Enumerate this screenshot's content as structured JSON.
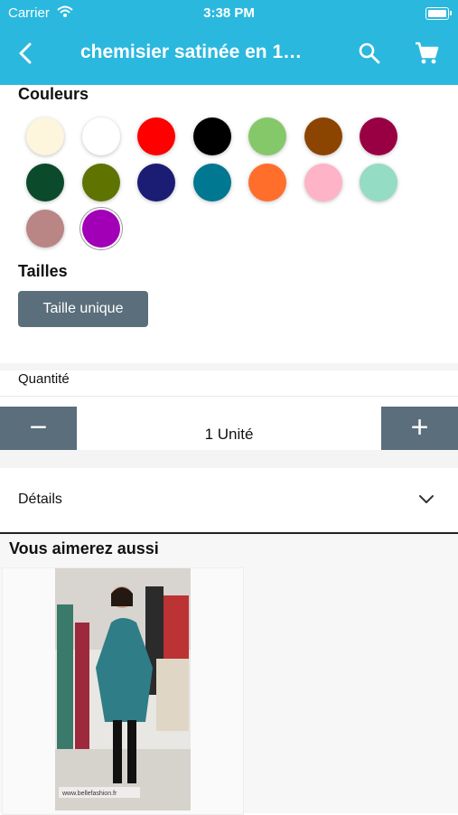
{
  "status_bar": {
    "carrier": "Carrier",
    "time": "3:38 PM"
  },
  "header": {
    "title": "chemisier satinée en 1…"
  },
  "colors": {
    "label": "Couleurs",
    "swatches": [
      "#fdf5dc",
      "#ffffff",
      "#ff0000",
      "#000000",
      "#84c86a",
      "#8b4500",
      "#990044",
      "#0b4a2b",
      "#5e7300",
      "#1b1d74",
      "#007891",
      "#ff6f2b",
      "#ffb3c6",
      "#94dcc4",
      "#b98585",
      "#a200b6"
    ],
    "selected_index": 15
  },
  "sizes": {
    "label": "Tailles",
    "options": [
      "Taille unique"
    ]
  },
  "quantity": {
    "label": "Quantité",
    "value_text": "1 Unité",
    "minus": "−",
    "plus": "+"
  },
  "details": {
    "label": "Détails"
  },
  "recommend": {
    "title": "Vous aimerez aussi",
    "watermark": "www.bellefashion.fr"
  }
}
